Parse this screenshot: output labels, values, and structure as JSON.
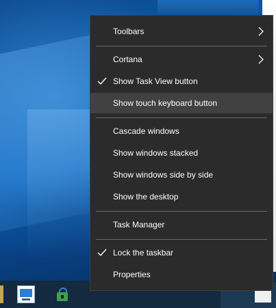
{
  "menu": {
    "items": [
      {
        "label": "Toolbars",
        "submenu": true,
        "checked": false
      },
      {
        "label": "Cortana",
        "submenu": true,
        "checked": false
      },
      {
        "label": "Show Task View button",
        "submenu": false,
        "checked": true
      },
      {
        "label": "Show touch keyboard button",
        "submenu": false,
        "checked": false,
        "highlighted": true
      },
      {
        "label": "Cascade windows",
        "submenu": false,
        "checked": false
      },
      {
        "label": "Show windows stacked",
        "submenu": false,
        "checked": false
      },
      {
        "label": "Show windows side by side",
        "submenu": false,
        "checked": false
      },
      {
        "label": "Show the desktop",
        "submenu": false,
        "checked": false
      },
      {
        "label": "Task Manager",
        "submenu": false,
        "checked": false
      },
      {
        "label": "Lock the taskbar",
        "submenu": false,
        "checked": true
      },
      {
        "label": "Properties",
        "submenu": false,
        "checked": false
      }
    ]
  },
  "taskbar": {
    "icons": [
      "computer-icon",
      "lock-icon"
    ]
  },
  "colors": {
    "menu_bg": "#2b2b2b",
    "menu_hover": "#414141",
    "taskbar_bg": "#132a3f"
  }
}
